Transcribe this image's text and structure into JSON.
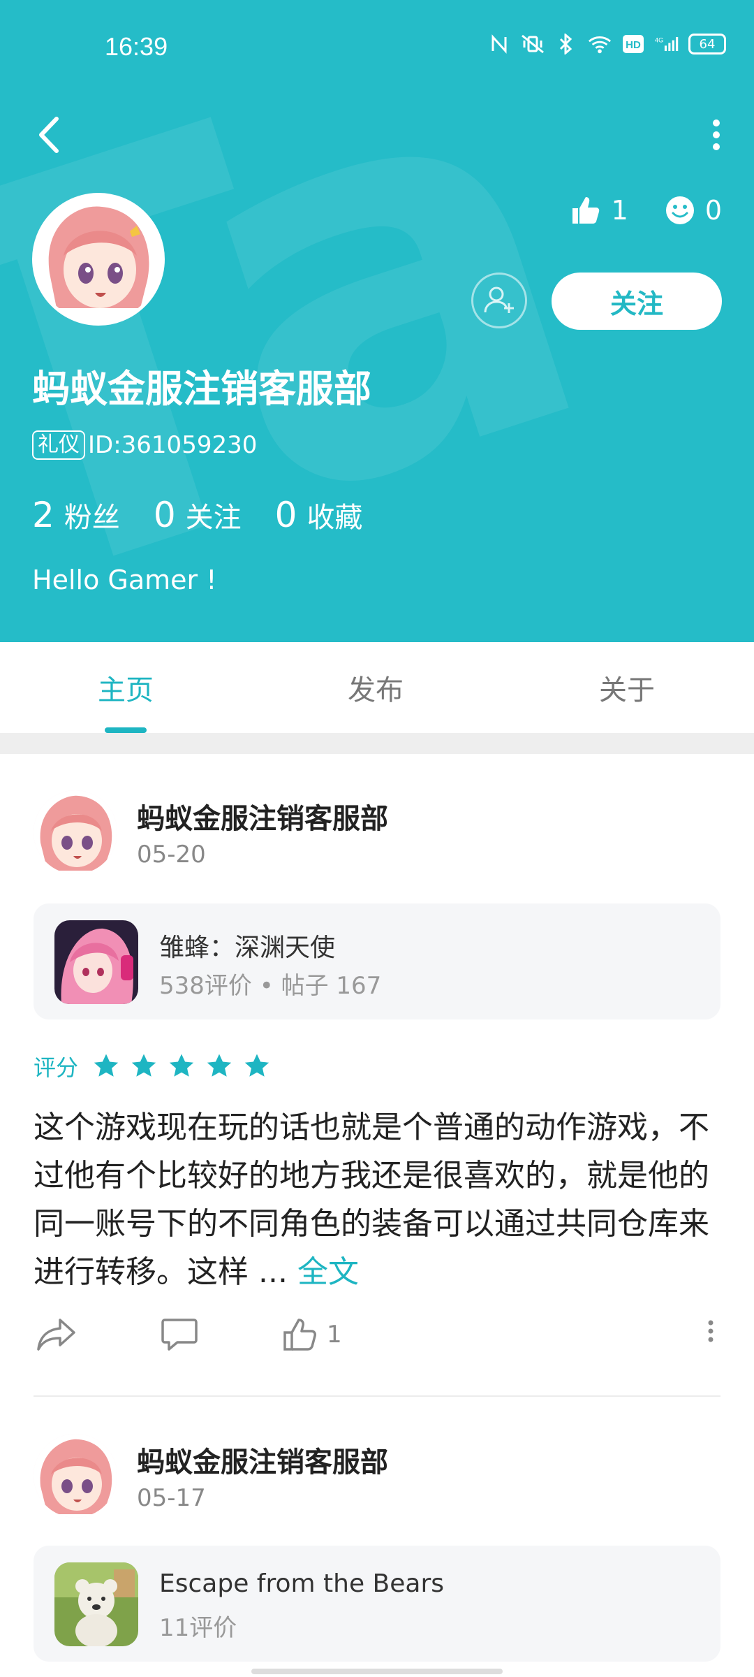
{
  "status_bar": {
    "time": "16:39",
    "battery": "64",
    "icons": [
      "nfc-icon",
      "vibrate-icon",
      "bluetooth-icon",
      "wifi-icon",
      "hd-icon",
      "signal-4g-icon",
      "battery-icon"
    ]
  },
  "profile": {
    "likes": "1",
    "smiles": "0",
    "follow_label": "关注",
    "name": "蚂蚁金服注销客服部",
    "badge": "礼仪",
    "id_text": "ID:361059230",
    "counts": [
      {
        "num": "2",
        "label": "粉丝"
      },
      {
        "num": "0",
        "label": "关注"
      },
      {
        "num": "0",
        "label": "收藏"
      }
    ],
    "bio": "Hello Gamer !"
  },
  "tabs": [
    {
      "label": "主页",
      "active": true
    },
    {
      "label": "发布",
      "active": false
    },
    {
      "label": "关于",
      "active": false
    }
  ],
  "posts": [
    {
      "author": "蚂蚁金服注销客服部",
      "date": "05-20",
      "game": {
        "title": "雏蜂：深渊天使",
        "meta": "538评价 • 帖子 167"
      },
      "rating_label": "评分",
      "stars": 5,
      "text": "这个游戏现在玩的话也就是个普通的动作游戏，不过他有个比较好的地方我还是很喜欢的，就是他的同一账号下的不同角色的装备可以通过共同仓库来进行转移。这样 ...",
      "full_link": "全文",
      "like_count": "1"
    },
    {
      "author": "蚂蚁金服注销客服部",
      "date": "05-17",
      "game": {
        "title": "Escape from the Bears",
        "meta": "11评价"
      }
    }
  ],
  "colors": {
    "accent": "#25bcc8",
    "link": "#1eb5c2"
  }
}
